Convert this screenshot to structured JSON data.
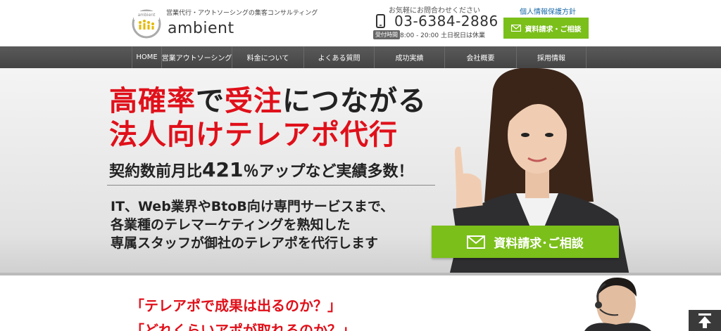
{
  "header": {
    "tagline": "営業代行・アウトソーシングの集客コンサルティング",
    "brand": "ambient",
    "logo_small_text": "ambient",
    "contact_note": "お気軽にお問合わせください",
    "phone": "03-6384-2886",
    "hours_badge": "受付時間",
    "hours": "8:00 - 20:00 土日祝日は休業",
    "privacy_link": "個人情報保護方針",
    "cta_label": "資料請求・ご相談"
  },
  "nav": {
    "items": [
      {
        "label": "HOME"
      },
      {
        "label": "営業アウトソーシング"
      },
      {
        "label": "料金について"
      },
      {
        "label": "よくある質問"
      },
      {
        "label": "成功実績"
      },
      {
        "label": "会社概要"
      },
      {
        "label": "採用情報"
      }
    ]
  },
  "hero": {
    "h1_part1": "高確率",
    "h1_part2": "で",
    "h1_part3": "受注",
    "h1_part4": "につながる",
    "h2": "法人向けテレアポ代行",
    "stat_pre": "契約数前月比",
    "stat_num": "421",
    "stat_post": "％アップなど実績多数！",
    "desc1": "IT、Web業界やBtoB向け専門サービスまで、",
    "desc2": "各業種のテレマーケティングを熟知した",
    "desc3": "専属スタッフが御社のテレアポを代行します",
    "cta_label": "資料請求･ご相談"
  },
  "lower": {
    "quote1": "「テレアポで成果は出るのか？」",
    "quote2": "「どれくらいアポが取れるのか？」"
  },
  "colors": {
    "accent_green": "#7bbf1a",
    "headline_red": "#e0101a",
    "nav_gray": "#4a4a4a"
  },
  "icons": [
    "logo-icon",
    "phone-icon",
    "mail-icon",
    "page-top-icon"
  ]
}
